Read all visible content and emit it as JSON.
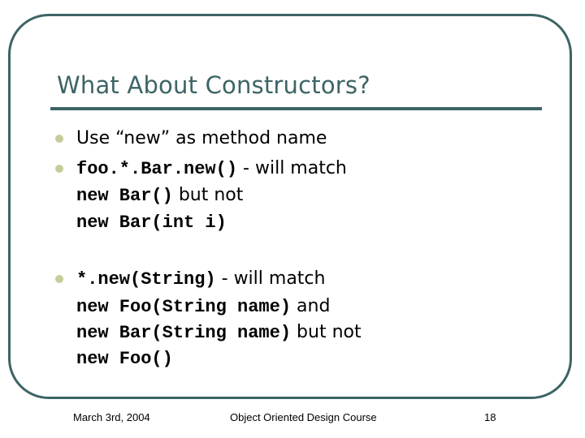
{
  "slide": {
    "title": "What About Constructors?",
    "bullets": [
      {
        "lines": [
          [
            {
              "type": "prose",
              "text": "Use “new” as method name"
            }
          ]
        ]
      },
      {
        "lines": [
          [
            {
              "type": "code",
              "text": "foo.*.Bar.new()"
            },
            {
              "type": "prose",
              "text": " - will match"
            }
          ],
          [
            {
              "type": "code",
              "text": "new Bar()"
            },
            {
              "type": "prose",
              "text": " but not"
            }
          ],
          [
            {
              "type": "code",
              "text": "new Bar(int i)"
            }
          ]
        ]
      },
      {
        "lines": [
          [
            {
              "type": "code",
              "text": "*.new(String)"
            },
            {
              "type": "prose",
              "text": " - will match"
            }
          ],
          [
            {
              "type": "code",
              "text": "new Foo(String name)"
            },
            {
              "type": "prose",
              "text": " and"
            }
          ],
          [
            {
              "type": "code",
              "text": "new Bar(String name)"
            },
            {
              "type": "prose",
              "text": " but not"
            }
          ],
          [
            {
              "type": "code",
              "text": "new Foo()"
            }
          ]
        ]
      }
    ]
  },
  "footer": {
    "date": "March 3rd, 2004",
    "course": "Object Oriented Design Course",
    "page_number": "18"
  },
  "colors": {
    "accent": "#3d6465",
    "bullet": "#c8cc9a",
    "text": "#000000"
  }
}
